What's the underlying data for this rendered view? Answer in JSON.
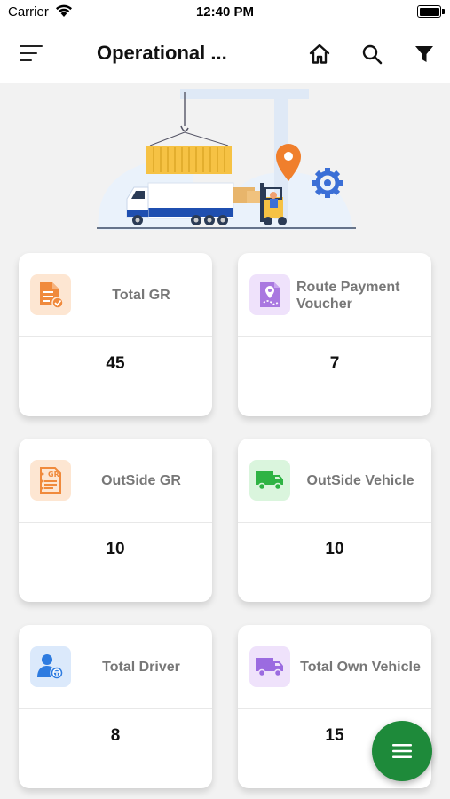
{
  "status_bar": {
    "carrier": "Carrier",
    "time": "12:40 PM"
  },
  "header": {
    "title": "Operational ...",
    "icons": [
      "menu-icon",
      "home-icon",
      "search-icon",
      "filter-icon"
    ]
  },
  "colors": {
    "fab": "#1e8a3a",
    "orange_tile": "#fde6d2",
    "purple_tile": "#efe2fb",
    "green_tile": "#daf5dd",
    "blue_tile": "#dbe9fb"
  },
  "cards": [
    {
      "label": "Total GR",
      "value": "45",
      "icon": "document-check-icon"
    },
    {
      "label": "Route Payment Voucher",
      "value": "7",
      "icon": "route-map-icon"
    },
    {
      "label": "OutSide GR",
      "value": "10",
      "icon": "gr-document-icon"
    },
    {
      "label": "OutSide Vehicle",
      "value": "10",
      "icon": "truck-icon"
    },
    {
      "label": "Total Driver",
      "value": "8",
      "icon": "driver-icon"
    },
    {
      "label": "Total Own Vehicle",
      "value": "15",
      "icon": "truck-icon"
    }
  ],
  "fab": {
    "icon": "menu-icon"
  }
}
